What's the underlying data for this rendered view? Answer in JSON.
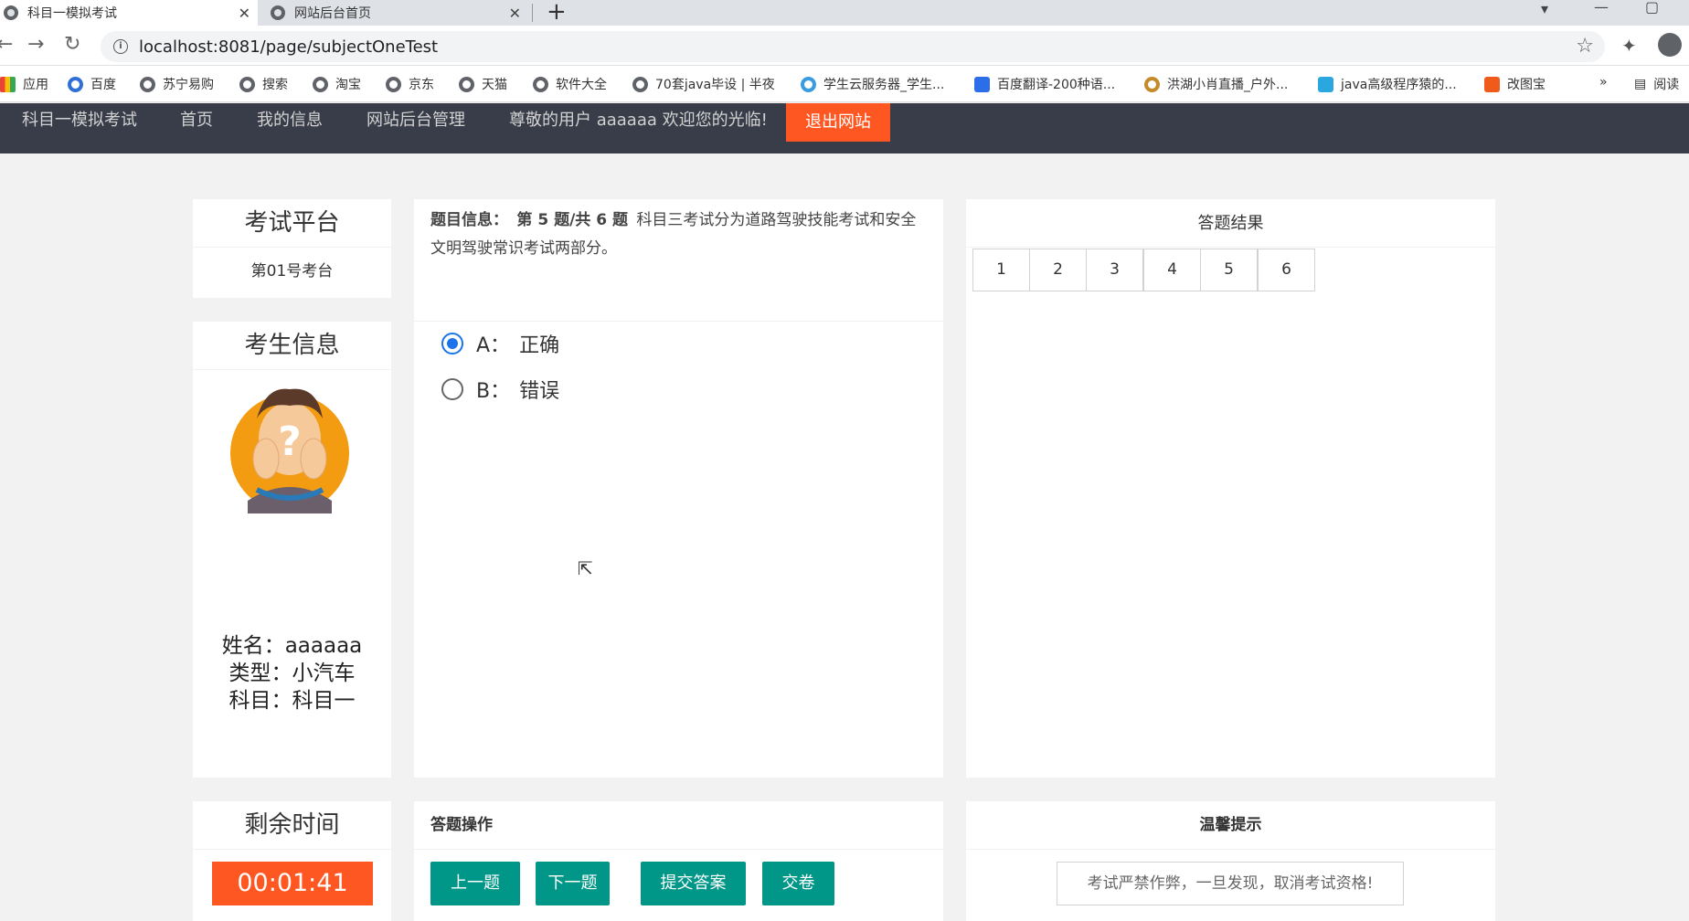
{
  "browser": {
    "tabs": [
      {
        "title": "科目一模拟考试",
        "active": true
      },
      {
        "title": "网站后台首页",
        "active": false
      }
    ],
    "url": "localhost:8081/page/subjectOneTest",
    "bookmarks": [
      "应用",
      "百度",
      "苏宁易购",
      "搜索",
      "淘宝",
      "京东",
      "天猫",
      "软件大全",
      "70套java毕设 | 半夜",
      "学生云服务器_学生...",
      "百度翻译-200种语...",
      "洪湖小肖直播_户外...",
      "java高级程序猿的...",
      "改图宝",
      "»",
      "阅读"
    ]
  },
  "nav": {
    "items": [
      "科目一模拟考试",
      "首页",
      "我的信息",
      "网站后台管理",
      "尊敬的用户 aaaaaa 欢迎您的光临!"
    ],
    "logout": "退出网站"
  },
  "platform": {
    "title": "考试平台",
    "station": "第01号考台"
  },
  "candidate": {
    "title": "考生信息",
    "name": "姓名：aaaaaa",
    "type": "类型：小汽车",
    "subject": "科目：科目一"
  },
  "question": {
    "label": "题目信息：",
    "progress": "第 5 题/共 6 题",
    "text": "科目三考试分为道路驾驶技能考试和安全文明驾驶常识考试两部分。",
    "options": [
      {
        "key": "A：",
        "text": "正确",
        "selected": true
      },
      {
        "key": "B：",
        "text": "错误",
        "selected": false
      }
    ]
  },
  "results": {
    "title": "答题结果",
    "numbers": [
      "1",
      "2",
      "3",
      "4",
      "5",
      "6"
    ]
  },
  "timer": {
    "title": "剩余时间",
    "value": "00:01:41"
  },
  "actions": {
    "title": "答题操作",
    "prev": "上一题",
    "next": "下一题",
    "submit": "提交答案",
    "finish": "交卷"
  },
  "tips": {
    "title": "温馨提示",
    "text": "考试严禁作弊，一旦发现，取消考试资格!"
  },
  "colors": {
    "nav_bg": "#393d49",
    "accent_red": "#ff5722",
    "button_green": "#009688"
  }
}
